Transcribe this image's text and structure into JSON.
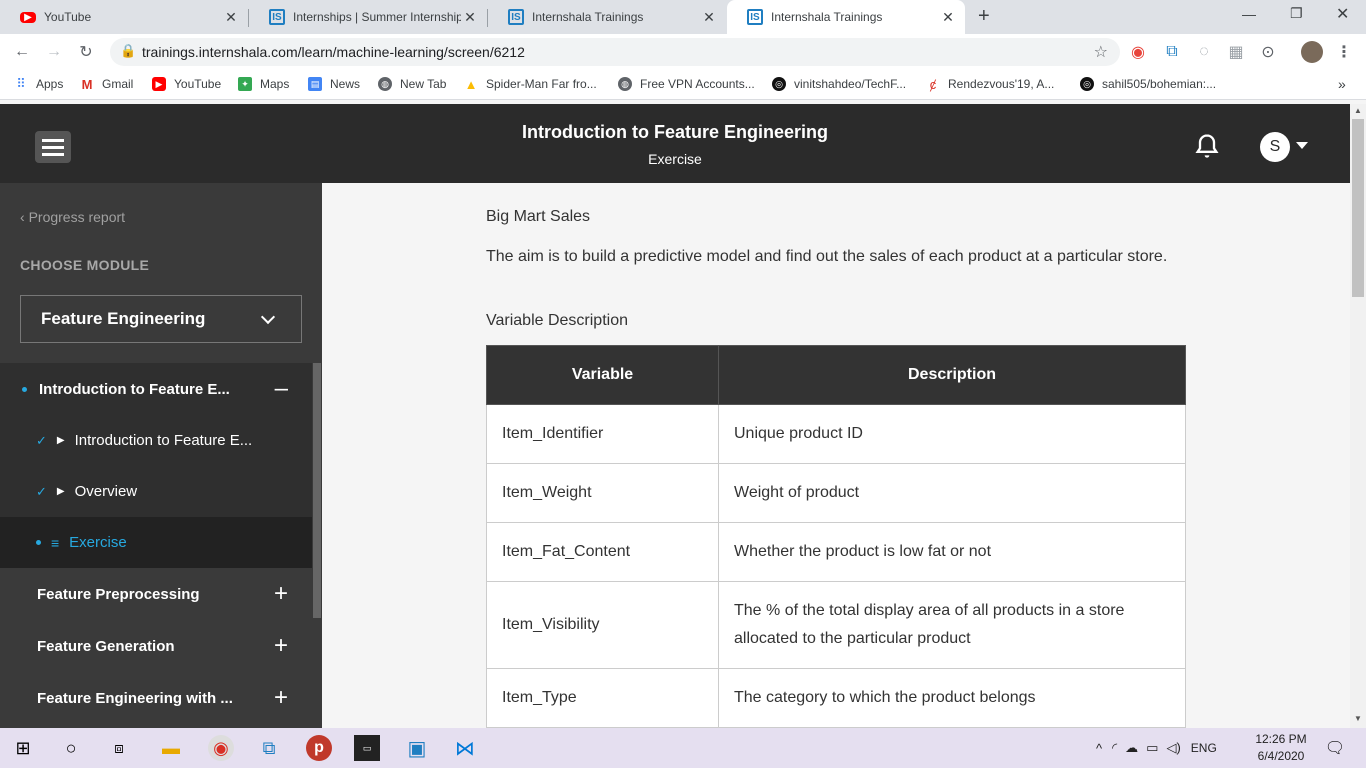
{
  "browser": {
    "tabs": [
      {
        "title": "YouTube",
        "favicon": "youtube-icon"
      },
      {
        "title": "Internships | Summer Internship",
        "favicon": "internshala-icon"
      },
      {
        "title": "Internshala Trainings",
        "favicon": "internshala-icon"
      },
      {
        "title": "Internshala Trainings",
        "favicon": "internshala-icon",
        "active": true
      }
    ],
    "new_tab_label": "+",
    "address": "trainings.internshala.com/learn/machine-learning/screen/6212",
    "bookmarks": [
      {
        "label": "Apps",
        "icon": "apps-grid-icon"
      },
      {
        "label": "Gmail",
        "icon": "gmail-icon"
      },
      {
        "label": "YouTube",
        "icon": "youtube-icon"
      },
      {
        "label": "Maps",
        "icon": "maps-icon"
      },
      {
        "label": "News",
        "icon": "news-icon"
      },
      {
        "label": "New Tab",
        "icon": "globe-icon"
      },
      {
        "label": "Spider-Man Far fro...",
        "icon": "drive-icon"
      },
      {
        "label": "Free VPN Accounts...",
        "icon": "globe-icon"
      },
      {
        "label": "vinitshahdeo/TechF...",
        "icon": "github-icon"
      },
      {
        "label": "Rendezvous'19, A...",
        "icon": "rendezvous-icon"
      },
      {
        "label": "sahil505/bohemian:...",
        "icon": "github-icon"
      }
    ],
    "more_bookmarks": "»"
  },
  "header": {
    "title": "Introduction to Feature Engineering",
    "subtitle": "Exercise",
    "avatar_letter": "S"
  },
  "sidebar": {
    "progress_label": "Progress report",
    "choose_module_label": "CHOOSE MODULE",
    "selected_module": "Feature Engineering",
    "sections": [
      {
        "label": "Introduction to Feature E...",
        "toggle": "–",
        "expanded": true,
        "items": [
          {
            "label": "Introduction to Feature E...",
            "icon": "play-icon",
            "done": true
          },
          {
            "label": "Overview",
            "icon": "play-icon",
            "done": true
          },
          {
            "label": "Exercise",
            "icon": "text-icon",
            "active": true
          }
        ]
      },
      {
        "label": "Feature Preprocessing",
        "toggle": "+"
      },
      {
        "label": "Feature Generation",
        "toggle": "+"
      },
      {
        "label": "Feature Engineering with ...",
        "toggle": "+"
      }
    ]
  },
  "content": {
    "heading": "Big Mart Sales",
    "intro": "The aim is to build a predictive model and find out the sales of each product at a particular store.",
    "var_heading": "Variable Description",
    "table": {
      "headers": [
        "Variable",
        "Description"
      ],
      "rows": [
        [
          "Item_Identifier",
          "Unique product ID"
        ],
        [
          "Item_Weight",
          "Weight of product"
        ],
        [
          "Item_Fat_Content",
          "Whether the product is low fat or not"
        ],
        [
          "Item_Visibility",
          "The % of the total display area of all products in a store allocated to the particular product"
        ],
        [
          "Item_Type",
          "The category to which the product belongs"
        ]
      ]
    }
  },
  "taskbar": {
    "lang": "ENG",
    "time": "12:26 PM",
    "date": "6/4/2020"
  },
  "colors": {
    "header_bg": "#2b2b2b",
    "sidebar_bg": "#3a3a3a",
    "accent": "#27a9e0"
  }
}
